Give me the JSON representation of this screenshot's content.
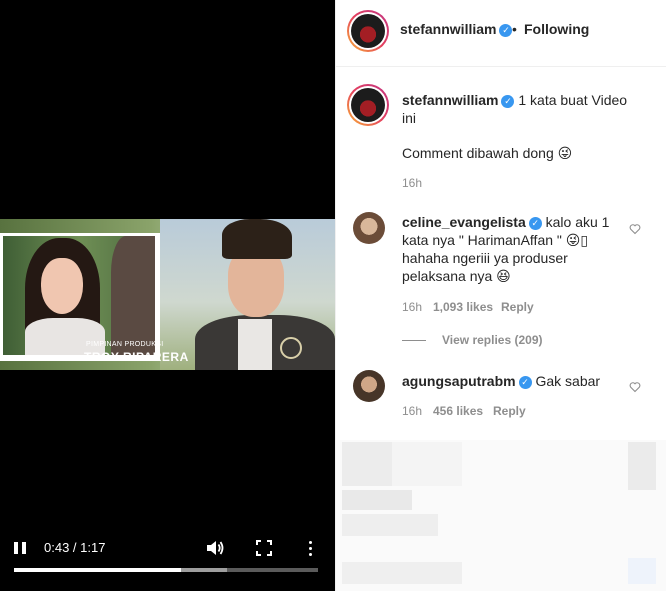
{
  "video": {
    "caption_small": "PIMPINAN PRODUKSI",
    "caption_big": "TROY RIPARERA",
    "time": "0:43 / 1:17",
    "played_fraction": 0.55,
    "buffered_fraction": 0.7,
    "icons": [
      "pause-icon",
      "volume-icon",
      "fullscreen-icon",
      "more-icon"
    ]
  },
  "header": {
    "username": "stefannwilliam",
    "separator": "•",
    "follow_status": "Following"
  },
  "post": {
    "username": "stefannwilliam",
    "caption_line1": "1 kata buat Video",
    "caption_line2": "ini",
    "caption_line3": "Comment dibawah dong 😜",
    "age": "16h"
  },
  "comments": [
    {
      "username": "celine_evangelista",
      "text_line1": "kalo aku 1",
      "text_line2": "kata nya \" HarimanAffan \" 😜▯",
      "text_line3": "hahaha ngeriii ya produser",
      "text_line4": "pelaksana nya 😆",
      "age": "16h",
      "likes": "1,093 likes",
      "reply": "Reply",
      "view_replies": "View replies (209)"
    },
    {
      "username": "agungsaputrabm",
      "text_line1": "Gak sabar",
      "age": "16h",
      "likes": "456 likes",
      "reply": "Reply"
    }
  ],
  "colors": {
    "verified": "#3897f0",
    "muted": "#8e8e8e",
    "text": "#262626"
  }
}
